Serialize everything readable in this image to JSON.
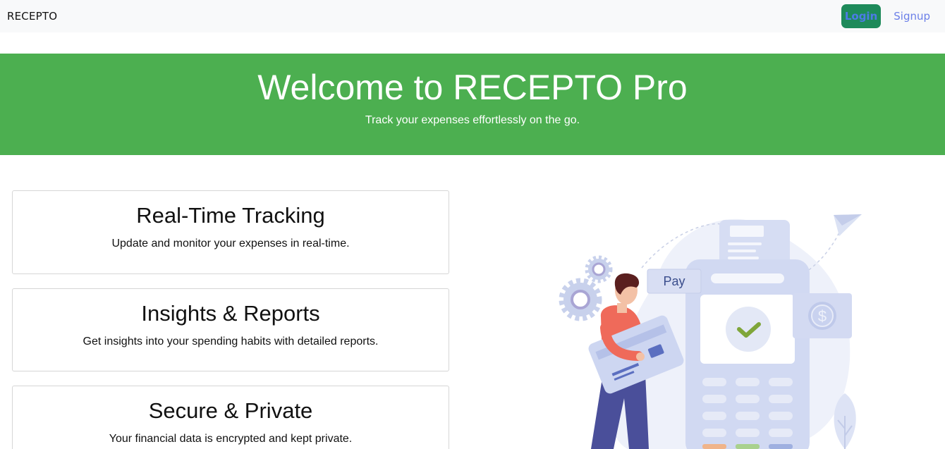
{
  "navbar": {
    "brand": "RECEPTO",
    "login_label": "Login",
    "signup_label": "Signup"
  },
  "hero": {
    "title": "Welcome to RECEPTO Pro",
    "subtitle": "Track your expenses effortlessly on the go."
  },
  "features": [
    {
      "title": "Real-Time Tracking",
      "description": "Update and monitor your expenses in real-time."
    },
    {
      "title": "Insights & Reports",
      "description": "Get insights into your spending habits with detailed reports."
    },
    {
      "title": "Secure & Private",
      "description": "Your financial data is encrypted and kept private."
    }
  ],
  "illustration": {
    "pay_label": "Pay",
    "currency_symbol": "$",
    "icons": [
      "payment-terminal",
      "credit-card",
      "gear-icon",
      "paper-plane-icon",
      "check-icon",
      "dollar-coin-icon"
    ]
  },
  "colors": {
    "hero_bg": "#4caf50",
    "login_bg": "#1e8a5a",
    "signup_text": "#6b7fe8"
  }
}
